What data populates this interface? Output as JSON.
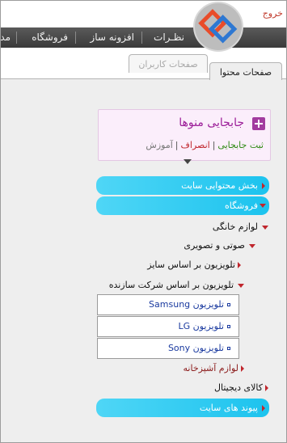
{
  "header": {
    "logout_label": "خروج"
  },
  "menu": {
    "items": [
      {
        "label": "نظـرات"
      },
      {
        "label": "افزونه ساز"
      },
      {
        "label": "فروشگاه"
      },
      {
        "label": "مد"
      }
    ]
  },
  "tabs": {
    "active": "صفحات محتوا",
    "inactive": "صفحات کاربران"
  },
  "relocate": {
    "title": "جابجایی منوها",
    "save_label": "ثبت جابجایی",
    "cancel_label": "انصراف",
    "help_label": "آموزش"
  },
  "tree": {
    "site_content": "بخش محتوایی سایت",
    "store": "فروشگاه",
    "home_appliances": "لوازم خانگی",
    "audio_video": "صوتی و تصویری",
    "tv_by_size": "تلویزیون بر اساس سایز",
    "tv_by_maker": "تلویزیون بر اساس شرکت سازنده",
    "tv_samsung": "تلویزیون Samsung",
    "tv_lg": "تلویزیون LG",
    "tv_sony": "تلویزیون Sony",
    "kitchen": "لوازم آشپزخانه",
    "digital": "کالای دیجیتال",
    "site_links": "پیوند های سایت"
  },
  "colors": {
    "accent_cyan": "#1cc3ee",
    "accent_purple": "#9b1c98",
    "danger_red": "#c0262d",
    "success_green": "#2f8a14"
  }
}
